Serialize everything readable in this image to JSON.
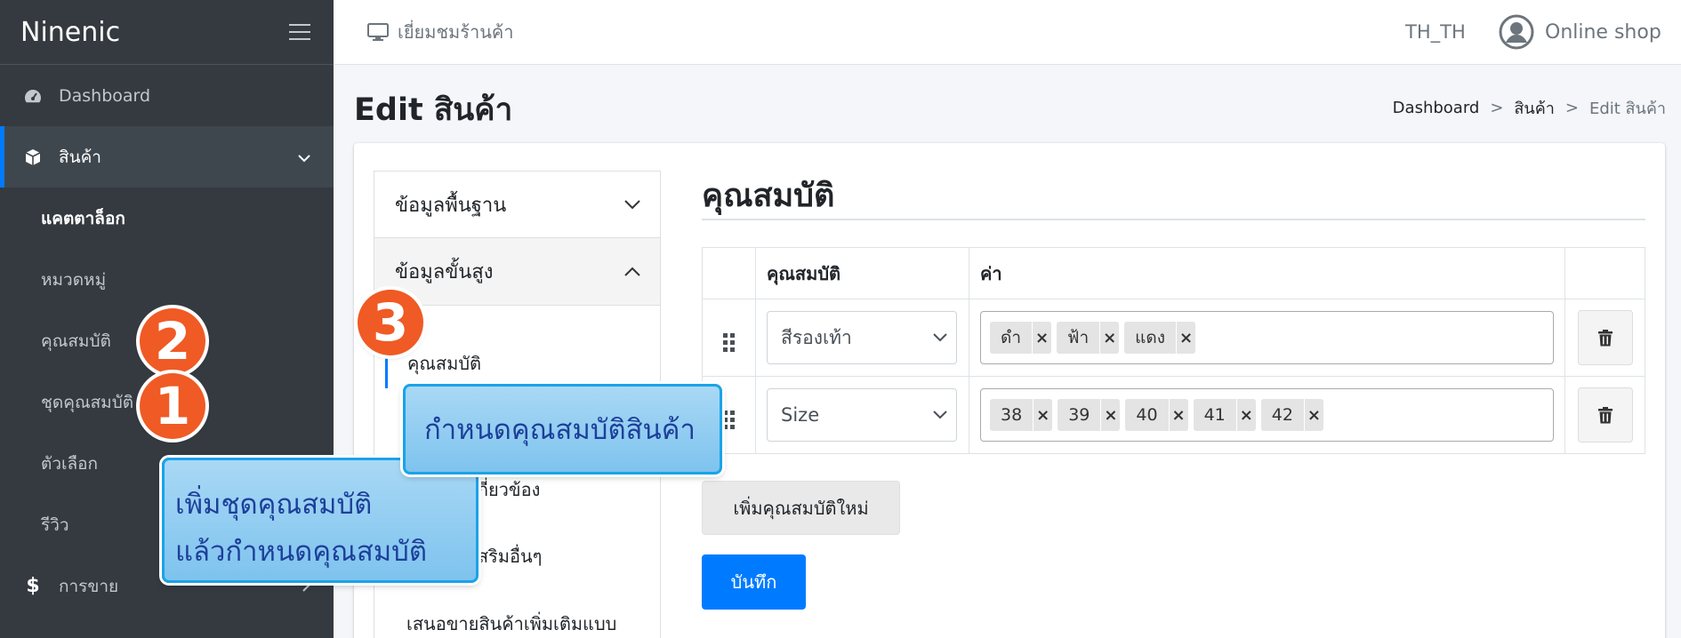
{
  "brand": "Ninenic",
  "sidebar": {
    "dashboard": "Dashboard",
    "products": "สินค้า",
    "sub_items": [
      "แคตตาล็อก",
      "หมวดหมู่",
      "คุณสมบัติ",
      "ชุดคุณสมบัติ",
      "ตัวเลือก",
      "รีวิว"
    ],
    "sales": "การขาย"
  },
  "topnav": {
    "view_store": "เยี่ยมชมร้านค้า",
    "lang": "TH_TH",
    "user": "Online shop"
  },
  "page": {
    "title": "Edit สินค้า",
    "breadcrumb": [
      "Dashboard",
      "สินค้า",
      "Edit สินค้า"
    ]
  },
  "left_menu": {
    "basic": "ข้อมูลพื้นฐาน",
    "advanced": "ข้อมูลขั้นสูง",
    "attributes": "คุณสมบัติ",
    "related": "เกี่ยวข้อง",
    "extras": "เสริมอื่นๆ",
    "upsell": "เสนอขายสินค้าเพิ่มเติมแบบ"
  },
  "attributes_section": {
    "title": "คุณสมบัติ",
    "col_attribute": "คุณสมบัติ",
    "col_value": "ค่า",
    "rows": [
      {
        "attribute": "สีรองเท้า",
        "values": [
          "ดำ",
          "ฟ้า",
          "แดง"
        ]
      },
      {
        "attribute": "Size",
        "values": [
          "38",
          "39",
          "40",
          "41",
          "42"
        ]
      }
    ],
    "add_button": "เพิ่มคุณสมบัติใหม่",
    "save_button": "บันทึก"
  },
  "callouts": {
    "badge1": "1",
    "badge2": "2",
    "badge3": "3",
    "note_attr_line1": "เพิ่มชุดคุณสมบัติ",
    "note_attr_line2": "แล้วกำหนดคุณสมบัติ",
    "note_product": "กำหนดคุณสมบัติสินค้า"
  },
  "colors": {
    "sidebar_bg": "#343a40",
    "accent": "#007bff",
    "badge": "#f05a24",
    "callout": "#8fcbf0"
  }
}
